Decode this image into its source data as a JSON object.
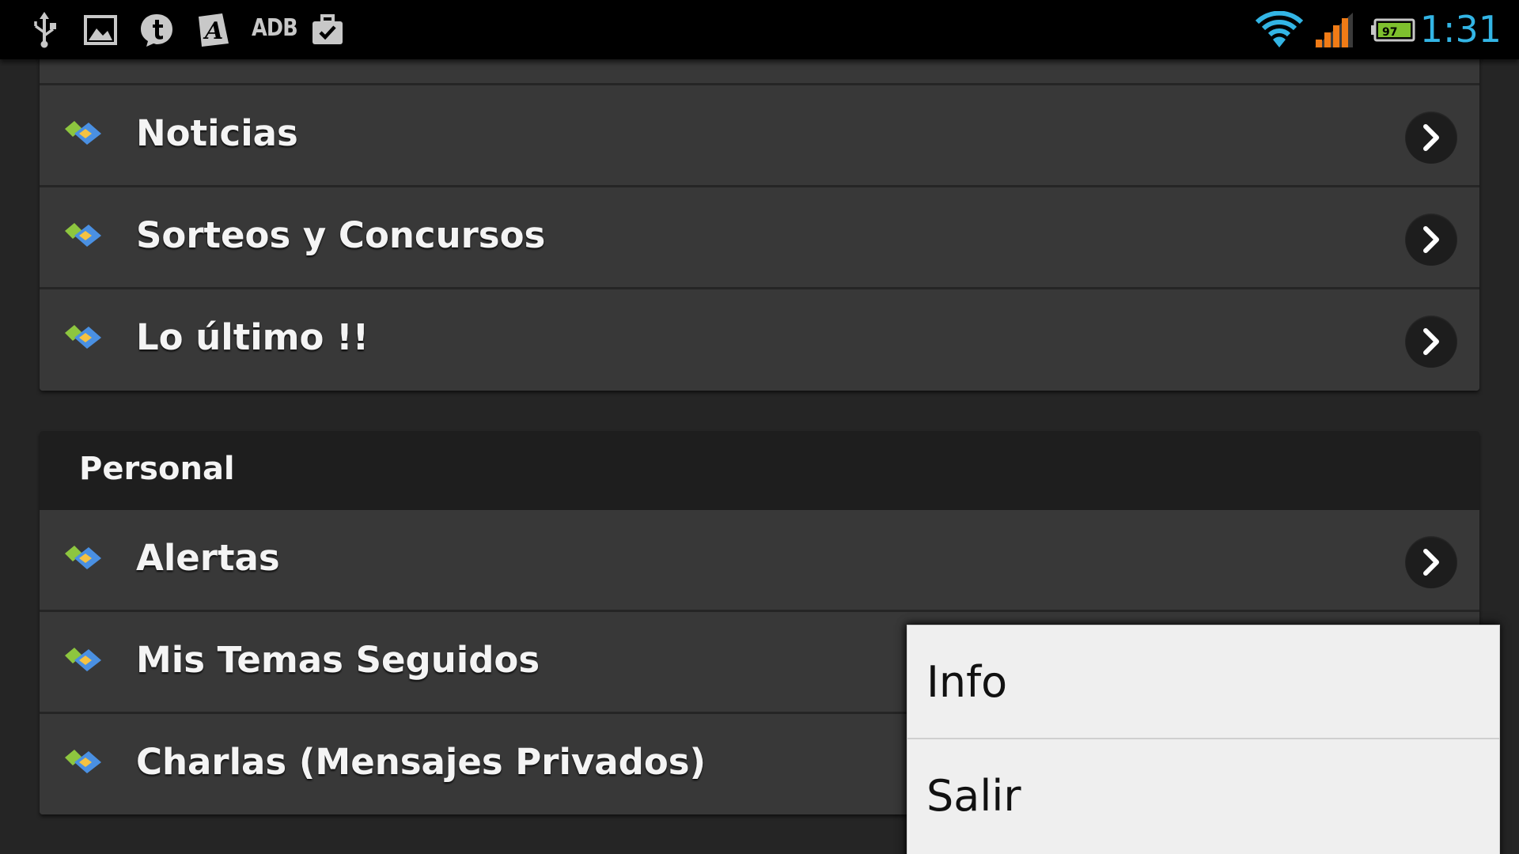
{
  "status_bar": {
    "time": "1:31",
    "battery_level": "97",
    "adb_label": "ADB",
    "icons": [
      "usb-icon",
      "gallery-icon",
      "tapatalk-icon",
      "font-app-icon",
      "adb-icon",
      "briefcase-check-icon",
      "wifi-icon",
      "signal-icon",
      "battery-icon"
    ],
    "time_color": "#33b5e5"
  },
  "top_card": {
    "items": [
      {
        "label": "Noticias"
      },
      {
        "label": "Sorteos y Concursos"
      },
      {
        "label": "Lo último !!"
      }
    ]
  },
  "personal_section": {
    "header": "Personal",
    "items": [
      {
        "label": "Alertas"
      },
      {
        "label": "Mis Temas Seguidos"
      },
      {
        "label": "Charlas (Mensajes Privados)"
      }
    ]
  },
  "overflow_menu": {
    "items": [
      {
        "label": "Info"
      },
      {
        "label": "Salir"
      }
    ]
  },
  "colors": {
    "background": "#252525",
    "row_background": "#383838",
    "header_background": "#1e1e1e",
    "menu_background": "#efefef",
    "forum_icon_green": "#8dc63f",
    "forum_icon_blue": "#4a90e2",
    "forum_icon_yellow": "#f5c242"
  }
}
